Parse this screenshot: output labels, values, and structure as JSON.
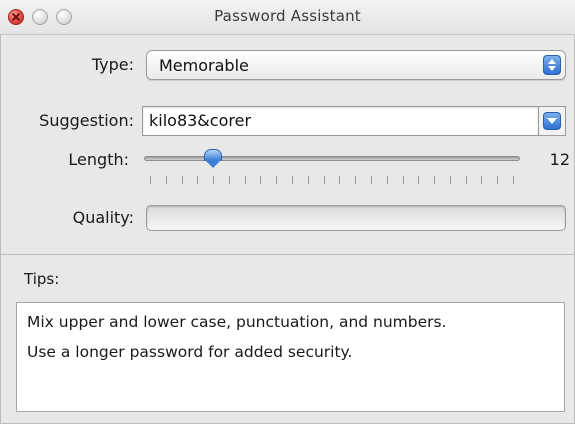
{
  "window": {
    "title": "Password Assistant"
  },
  "type": {
    "label": "Type:",
    "selected": "Memorable"
  },
  "suggestion": {
    "label": "Suggestion:",
    "value": "kilo83&corer"
  },
  "length": {
    "label": "Length:",
    "value": "12",
    "min": 8,
    "max": 31,
    "current": 12
  },
  "quality": {
    "label": "Quality:",
    "level": 0
  },
  "tips": {
    "label": "Tips:",
    "lines": [
      "Mix upper and lower case, punctuation, and numbers.",
      "Use a longer password for added security."
    ]
  },
  "colors": {
    "accent": "#3d7fd6",
    "close_button": "#e24b43"
  },
  "icons": {
    "close": "close-icon",
    "minimize": "minimize-icon",
    "zoom": "zoom-icon",
    "popup_stepper": "updown-arrows-icon",
    "dropdown": "chevron-down-icon"
  }
}
